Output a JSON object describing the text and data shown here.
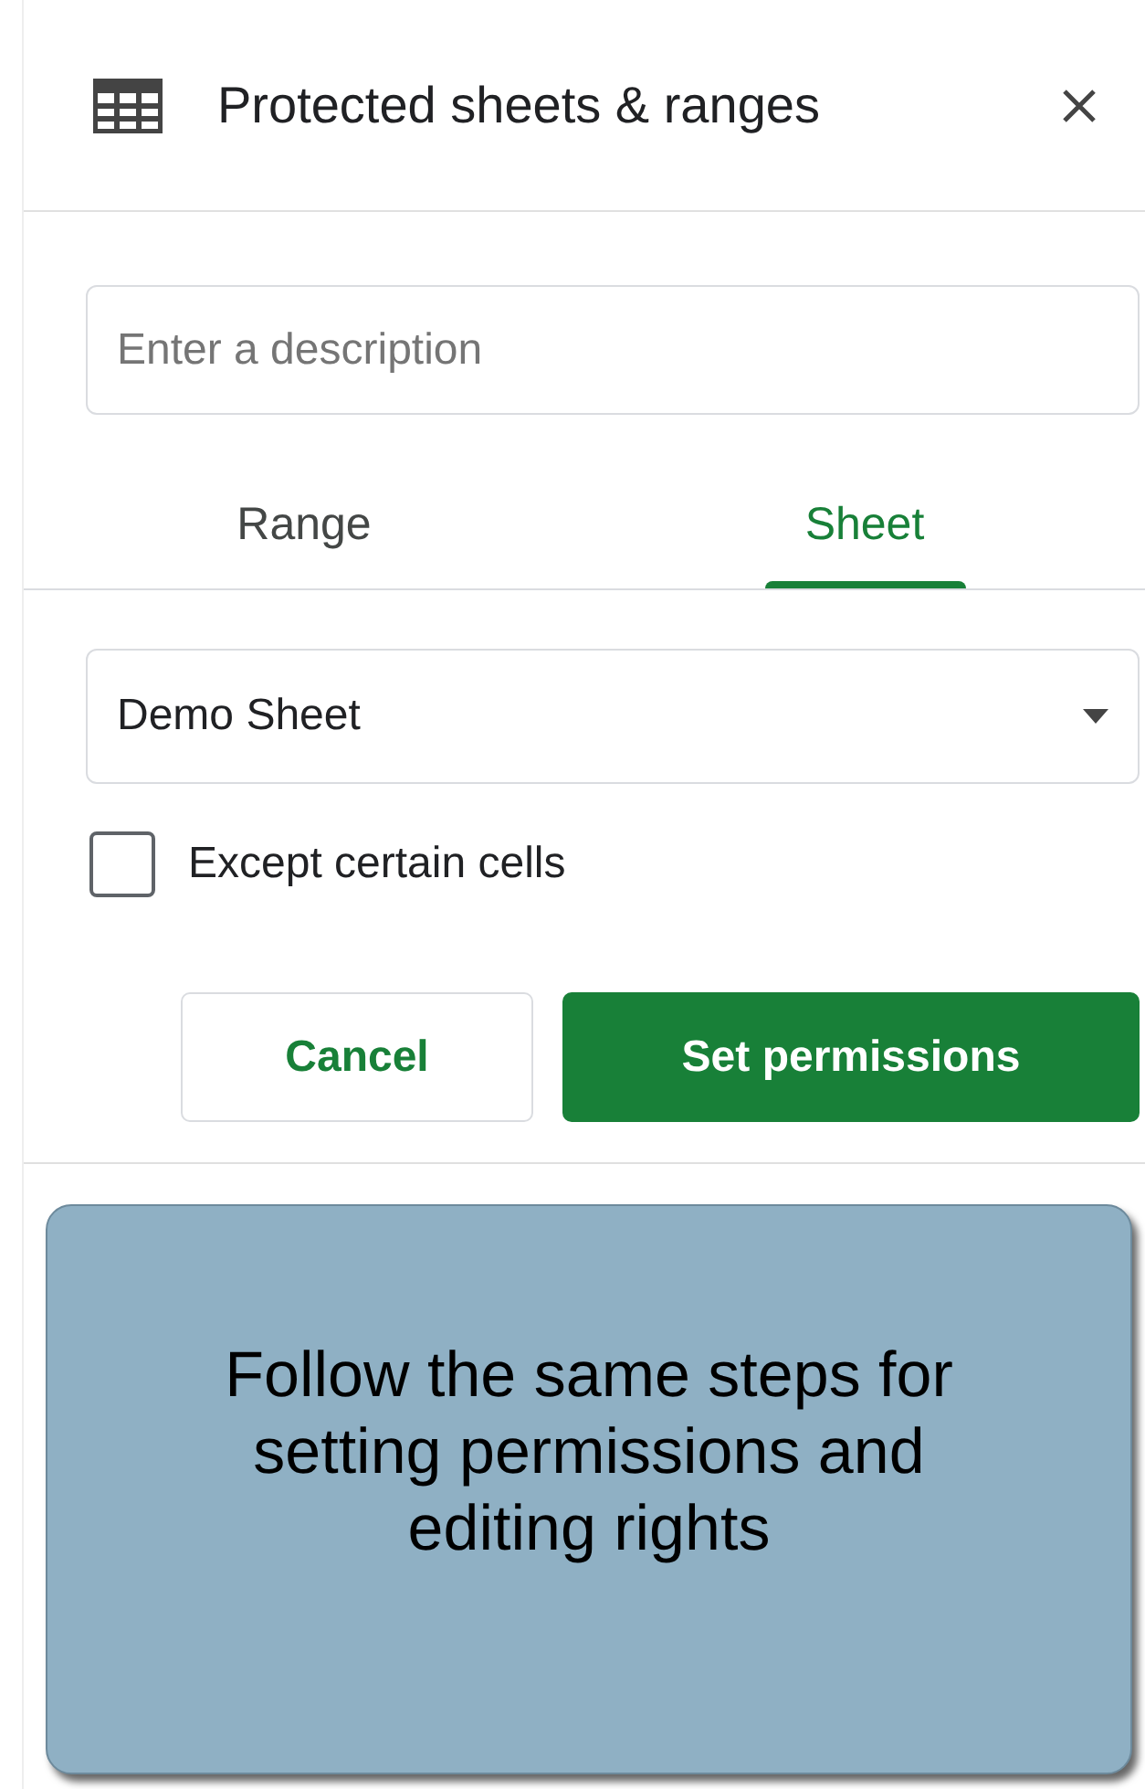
{
  "panel": {
    "title": "Protected sheets & ranges"
  },
  "description": {
    "placeholder": "Enter a description"
  },
  "tabs": [
    {
      "label": "Range",
      "selected": false
    },
    {
      "label": "Sheet",
      "selected": true
    }
  ],
  "sheet_select": {
    "value": "Demo Sheet"
  },
  "checkbox": {
    "label": "Except certain cells",
    "checked": false
  },
  "buttons": [
    {
      "label": "Cancel",
      "kind": "secondary"
    },
    {
      "label": "Set permissions",
      "kind": "primary"
    }
  ],
  "callout": {
    "text": "Follow the same steps for setting permissions and editing rights"
  }
}
